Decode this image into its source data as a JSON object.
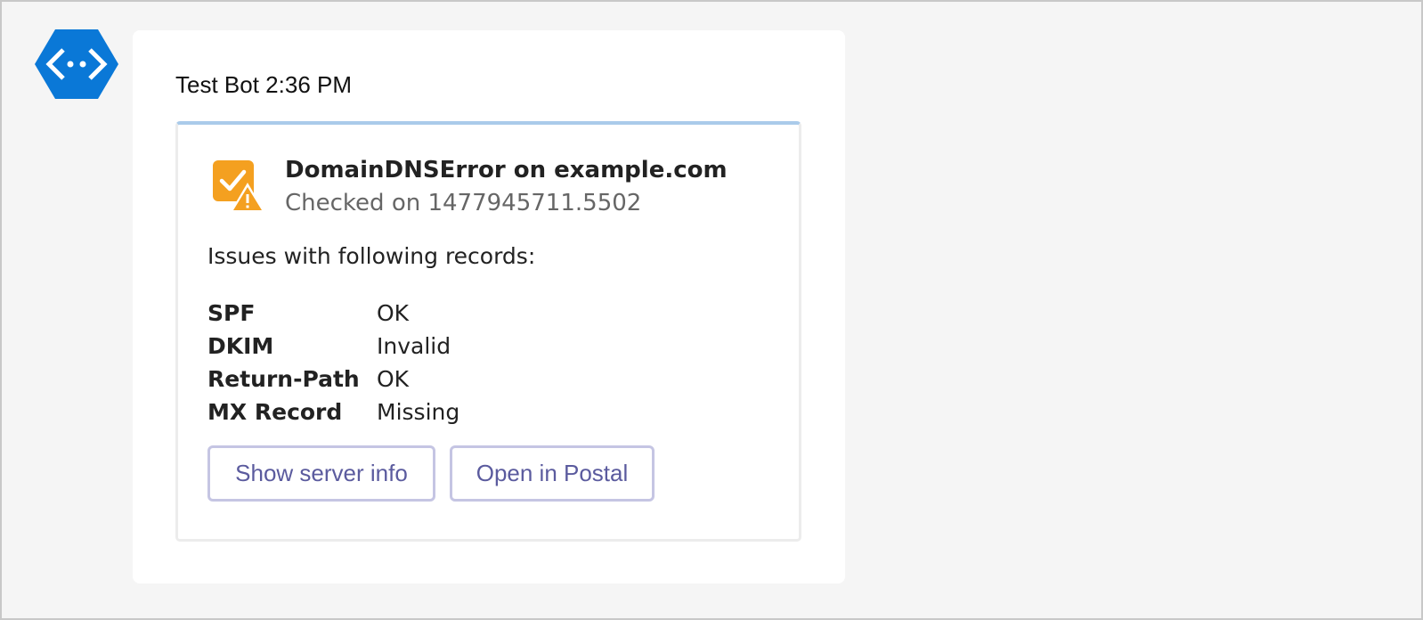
{
  "bot": {
    "avatar_icon": "bot-code-icon",
    "avatar_color": "#0a78d7"
  },
  "message": {
    "sender": "Test Bot",
    "time": "2:36 PM"
  },
  "card": {
    "icon": "check-warning-icon",
    "icon_color": "#f4a020",
    "title": "DomainDNSError on example.com",
    "subtitle": "Checked on 1477945711.5502",
    "intro": "Issues with following records:",
    "facts": [
      {
        "key": "SPF",
        "value": "OK"
      },
      {
        "key": "DKIM",
        "value": "Invalid"
      },
      {
        "key": "Return-Path",
        "value": "OK"
      },
      {
        "key": "MX Record",
        "value": "Missing"
      }
    ],
    "actions": [
      {
        "label": "Show server info"
      },
      {
        "label": "Open in Postal"
      }
    ]
  }
}
